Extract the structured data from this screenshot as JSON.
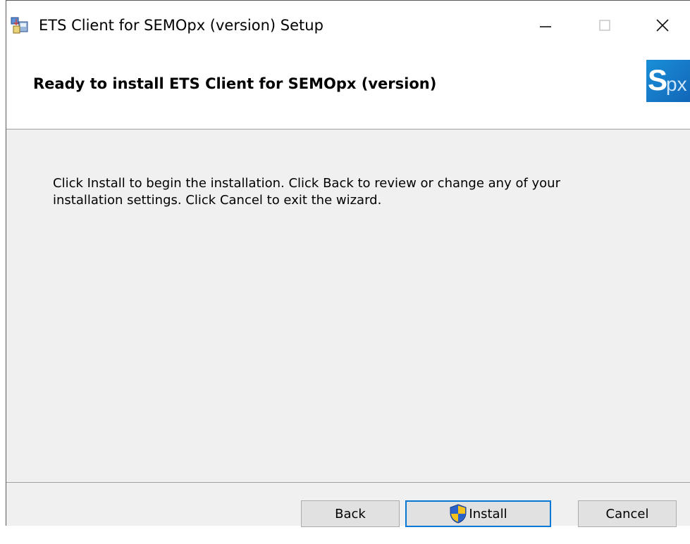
{
  "window": {
    "title": "ETS Client for SEMOpx (version) Setup"
  },
  "header": {
    "title": "Ready to install ETS Client for SEMOpx (version)",
    "logo": {
      "main": "S",
      "suffix": "px",
      "color": "#1a7fd0"
    }
  },
  "main": {
    "message": "Click Install to begin the installation. Click Back to review or change any of your installation settings. Click Cancel to exit the wizard."
  },
  "buttons": {
    "back": "Back",
    "install": "Install",
    "cancel": "Cancel"
  },
  "icons": {
    "app": "installer-icon",
    "install": "uac-shield-icon"
  },
  "colors": {
    "accent": "#0078d7",
    "dialog_bg": "#f0f0f0"
  }
}
